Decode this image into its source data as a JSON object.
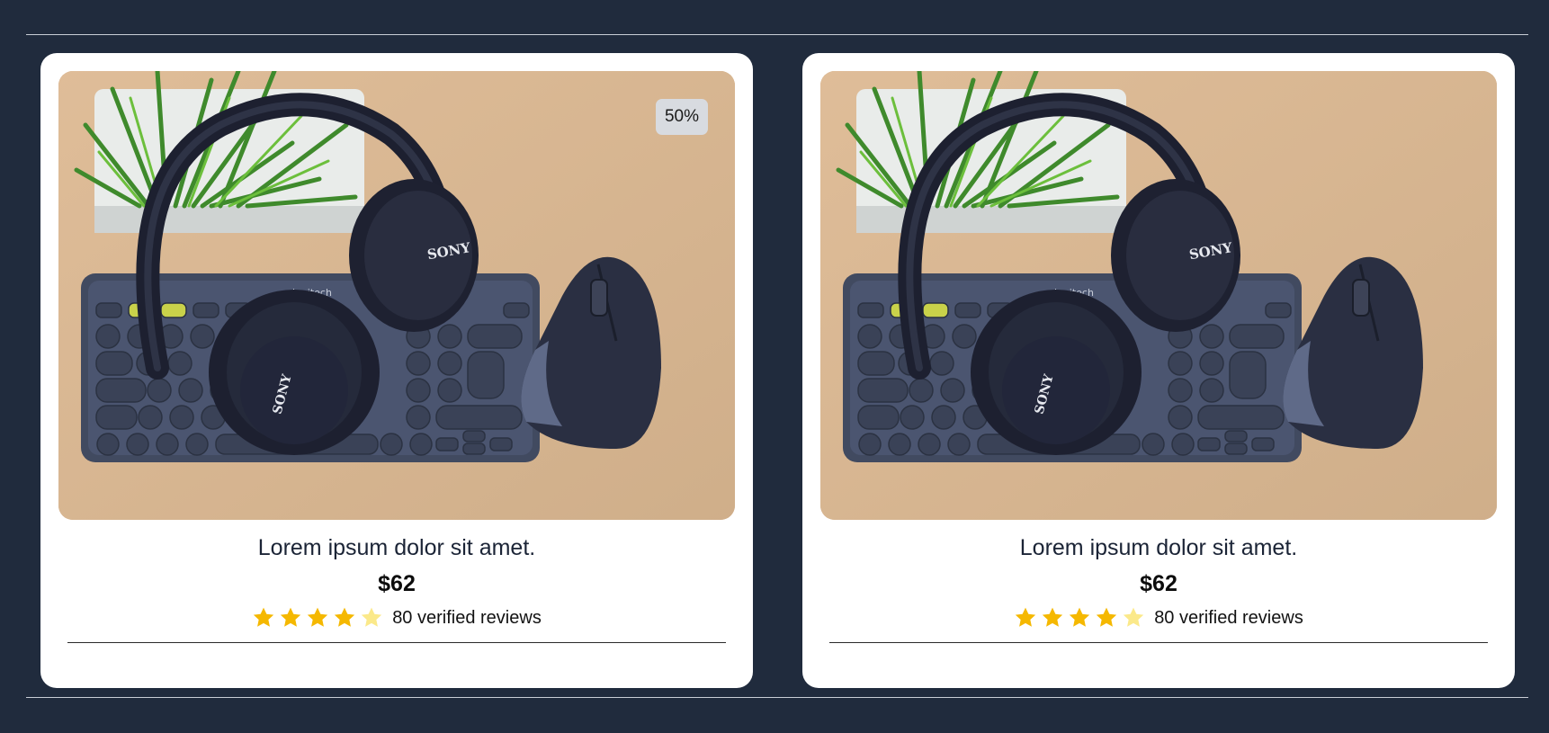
{
  "colors": {
    "page_background": "#202b3d",
    "card_background": "#ffffff",
    "star_filled": "#f5b800",
    "star_empty": "#fbe98a",
    "badge_background": "#d8dbe0"
  },
  "products": [
    {
      "image_alt": "headphones-keyboard-mouse-photo",
      "discount": "50%",
      "title": "Lorem ipsum dolor sit amet.",
      "price": "$62",
      "rating": 4,
      "rating_max": 5,
      "reviews": "80 verified reviews"
    },
    {
      "image_alt": "headphones-keyboard-mouse-photo",
      "discount": "",
      "title": "Lorem ipsum dolor sit amet.",
      "price": "$62",
      "rating": 4,
      "rating_max": 5,
      "reviews": "80 verified reviews"
    }
  ]
}
